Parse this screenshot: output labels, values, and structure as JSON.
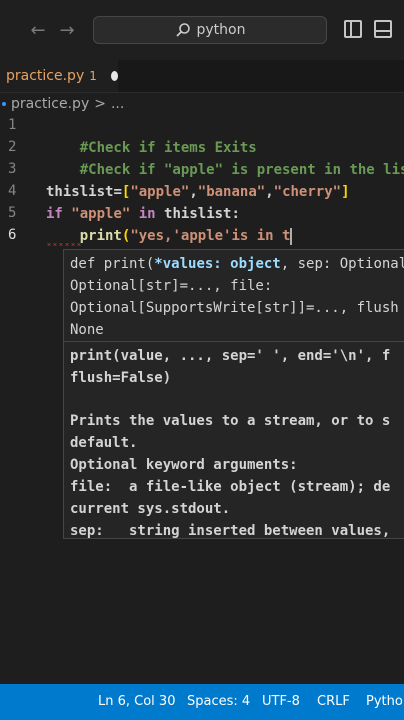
{
  "titlebar": {
    "search_text": "python"
  },
  "tab": {
    "name": "practice.py",
    "modified_count": "1"
  },
  "breadcrumb": {
    "file": "practice.py",
    "separator": ">",
    "more": "..."
  },
  "line_numbers": [
    "1",
    "2",
    "3",
    "4",
    "5",
    "6"
  ],
  "code": {
    "line1": "#Check if items Exits",
    "line2": "#Check if \"apple\" is present in the list",
    "line4_ident": "thislist",
    "line4_eq": "=",
    "line4_open": "[",
    "line4_s1": "\"apple\"",
    "line4_c1": ",",
    "line4_s2": "\"banana\"",
    "line4_c2": ",",
    "line4_s3": "\"cherry\"",
    "line4_close": "]",
    "line5_if": "if",
    "line5_str": "\"apple\"",
    "line5_in": "in",
    "line5_ident": "thislist",
    "line5_colon": ":",
    "line6_fn": "print",
    "line6_paren": "(",
    "line6_str": "\"yes,'apple'is in t"
  },
  "hover": {
    "sig_prefix": "def print(",
    "sig_param": "*values: object",
    "sig_rest": ", sep: Optional",
    "sig_line2": "Optional[str]=..., file:",
    "sig_line3": "Optional[SupportsWrite[str]]=..., flush",
    "sig_line4": "None",
    "doc_line1": "print(value, ..., sep=' ', end='\\n', f",
    "doc_line2": "flush=False)",
    "doc_line3": "Prints the values to a stream, or to s",
    "doc_line4": "default.",
    "doc_line5": "Optional keyword arguments:",
    "doc_line6": "file:  a file-like object (stream); de",
    "doc_line7": "current sys.stdout.",
    "doc_line8": "sep:   string inserted between values,"
  },
  "statusbar": {
    "position": "Ln 6, Col 30",
    "spaces": "Spaces: 4",
    "encoding": "UTF-8",
    "eol": "CRLF",
    "language": "Python"
  },
  "colors": {
    "statusbar_bg": "#007acc",
    "comment": "#6a9955",
    "keyword": "#c586c0",
    "string": "#ce9178",
    "function": "#dcdcaa",
    "tab_modified": "#e7a262"
  },
  "icons": {
    "back": "arrow-left-icon",
    "forward": "arrow-right-icon",
    "search": "search-icon",
    "layout": "toggle-sidebar-icon",
    "panel": "toggle-panel-icon"
  }
}
